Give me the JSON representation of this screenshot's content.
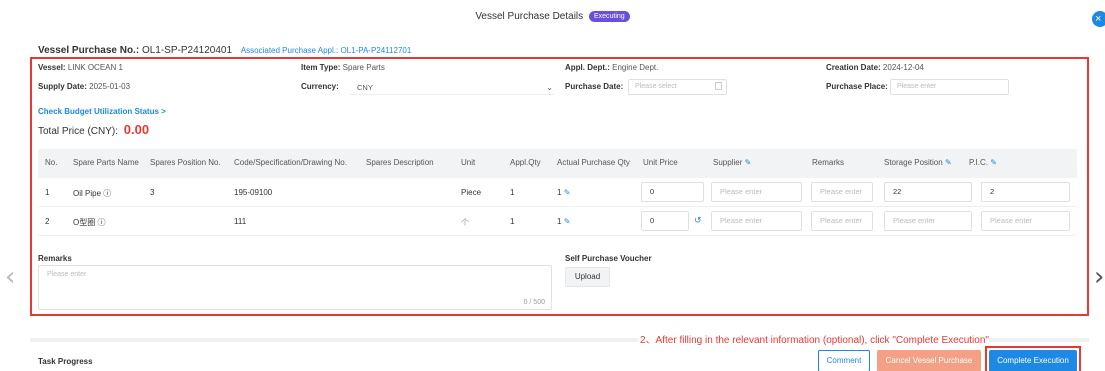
{
  "modal": {
    "title": "Vessel Purchase Details",
    "status": "Executing",
    "close_glyph": "×"
  },
  "header": {
    "vp_label": "Vessel Purchase No.:",
    "vp_value": "OL1-SP-P24120401",
    "assoc_label": "Associated Purchase Appl.:",
    "assoc_value": "OL1-PA-P24112701"
  },
  "info": {
    "vessel_label": "Vessel:",
    "vessel_value": "LINK OCEAN 1",
    "item_type_label": "Item Type:",
    "item_type_value": "Spare Parts",
    "appl_dept_label": "Appl. Dept.:",
    "appl_dept_value": "Engine Dept.",
    "creation_date_label": "Creation Date:",
    "creation_date_value": "2024-12-04",
    "supply_date_label": "Supply Date:",
    "supply_date_value": "2025-01-03",
    "currency_label": "Currency:",
    "currency_value": "CNY",
    "purchase_date_label": "Purchase Date:",
    "purchase_date_placeholder": "Please select",
    "purchase_place_label": "Purchase Place:",
    "purchase_place_placeholder": "Please enter"
  },
  "budget_link": "Check Budget Utilization Status >",
  "total": {
    "label": "Total Price (CNY):",
    "value": "0.00"
  },
  "table": {
    "headers": {
      "no": "No.",
      "name": "Spare Parts Name",
      "position": "Spares Position No.",
      "code": "Code/Specification/Drawing No.",
      "desc": "Spares Description",
      "unit": "Unit",
      "appl_qty": "Appl.Qty",
      "actual_qty": "Actual Purchase Qty",
      "unit_price": "Unit Price",
      "supplier": "Supplier",
      "remarks": "Remarks",
      "storage": "Storage Position",
      "pic": "P.I.C."
    },
    "rows": [
      {
        "no": "1",
        "name": "Oil Pipe ⓘ",
        "position": "3",
        "code": "195-09100",
        "unit": "Piece",
        "appl_qty": "1",
        "actual_qty": "1",
        "unit_price": "0",
        "supplier": "Please enter",
        "remarks": "Please enter",
        "storage": "22",
        "pic": "2"
      },
      {
        "no": "2",
        "name": "O型圈 ⓘ",
        "position": "",
        "code": "111",
        "unit": "个",
        "appl_qty": "1",
        "actual_qty": "1",
        "unit_price": "0",
        "supplier": "Please enter",
        "remarks": "Please enter",
        "storage": "Please enter",
        "pic": "Please enter"
      }
    ]
  },
  "remarks": {
    "label": "Remarks",
    "placeholder": "Please enter",
    "count": "0 / 500"
  },
  "voucher": {
    "label": "Self Purchase Voucher",
    "upload": "Upload"
  },
  "annotation": "2、After filling in the relevant information (optional), click \"Complete Execution\"",
  "footer": {
    "task_progress": "Task Progress",
    "comment": "Comment",
    "cancel": "Cancel Vessel Purchase",
    "complete": "Complete Execution"
  },
  "colors": {
    "accent": "#1e88e5",
    "status": "#6b4fd8",
    "highlight": "#e53935",
    "cancel": "#f4a084"
  }
}
